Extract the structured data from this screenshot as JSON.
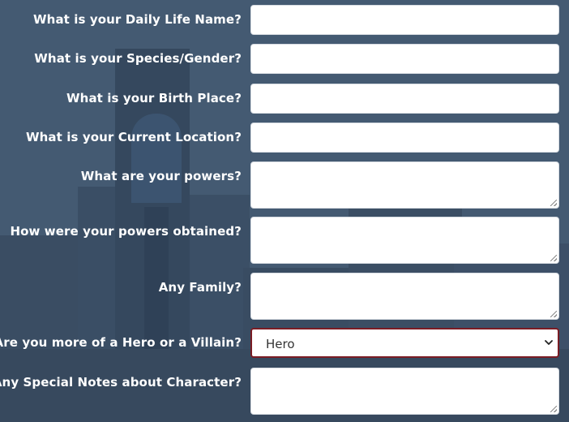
{
  "form": {
    "fields": [
      {
        "label": "What is your Daily Life Name?",
        "type": "input",
        "value": ""
      },
      {
        "label": "What is your Species/Gender?",
        "type": "input",
        "value": ""
      },
      {
        "label": "What is your Birth Place?",
        "type": "input",
        "value": ""
      },
      {
        "label": "What is your Current Location?",
        "type": "input",
        "value": ""
      },
      {
        "label": "What are your powers?",
        "type": "textarea",
        "value": ""
      },
      {
        "label": "How were your powers obtained?",
        "type": "textarea",
        "value": ""
      },
      {
        "label": "Any Family?",
        "type": "textarea",
        "value": ""
      },
      {
        "label": "Are you more of a Hero or a Villain?",
        "type": "select",
        "value": "Hero"
      },
      {
        "label": "Any Special Notes about Character?",
        "type": "textarea",
        "value": ""
      }
    ]
  },
  "colors": {
    "background": "#445a72",
    "select_border": "#7a1c24",
    "label_text": "#ffffff"
  },
  "icons": {
    "select": "chevron-down-icon",
    "textarea": "resize-grip-icon"
  }
}
